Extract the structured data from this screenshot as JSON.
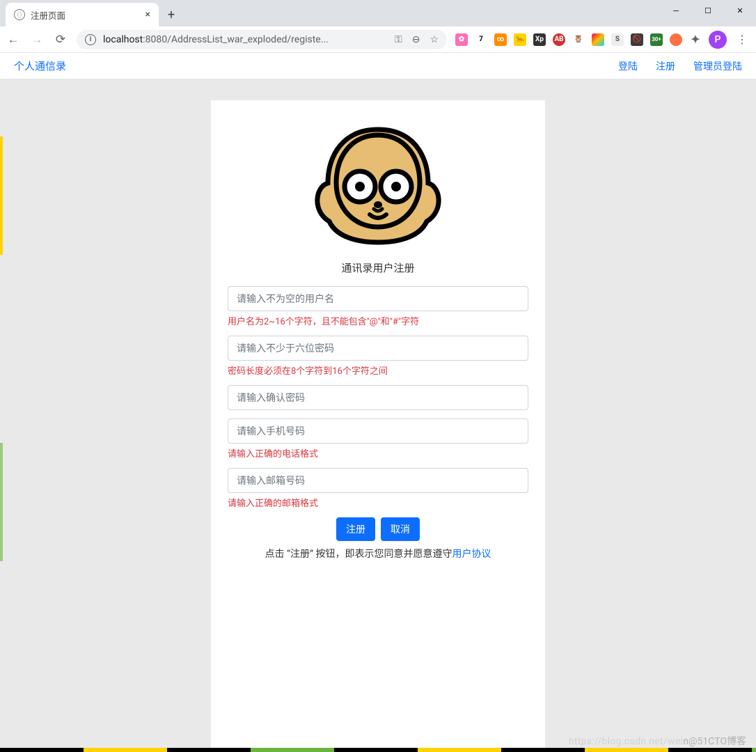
{
  "browser": {
    "tab_title": "注册页面",
    "url_host": "localhost",
    "url_rest": ":8080/AddressList_war_exploded/registe...",
    "avatar_letter": "P",
    "ext_7": "7",
    "ext_30": "30+"
  },
  "nav": {
    "brand": "个人通信录",
    "login": "登陆",
    "register": "注册",
    "admin_login": "管理员登陆"
  },
  "form": {
    "title": "通讯录用户注册",
    "username_ph": "请输入不为空的用户名",
    "username_err": "用户名为2~16个字符，且不能包含\"@\"和\"#\"字符",
    "password_ph": "请输入不少于六位密码",
    "password_err": "密码长度必须在8个字符到16个字符之间",
    "confirm_ph": "请输入确认密码",
    "phone_ph": "请输入手机号码",
    "phone_err": "请输入正确的电话格式",
    "email_ph": "请输入邮箱号码",
    "email_err": "请输入正确的邮箱格式",
    "submit": "注册",
    "cancel": "取消",
    "agree_prefix": "点击 “注册” 按钮，即表示您同意并愿意遵守",
    "agree_link": "用户协议"
  },
  "watermark": {
    "faint": "https://blog.csdn.net/wei",
    "main": "n@51CTO博客"
  }
}
